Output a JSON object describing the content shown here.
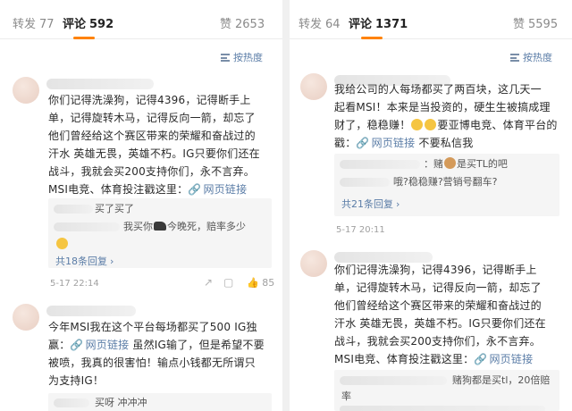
{
  "left": {
    "tabs": {
      "repost_label": "转发",
      "repost_count": "77",
      "comment_label": "评论",
      "comment_count": "592",
      "like_label": "赞",
      "like_count": "2653"
    },
    "sort_label": "按热度",
    "comment1": {
      "lines": [
        "你们记得洗澡狗，记得4396，记得断手上",
        "单，记得旋转木马，记得反向一箭，却忘了",
        "他们曾经给这个赛区带来的荣耀和奋战过的",
        "汗水 英雄无畏，英雄不朽。IG只要你们还在",
        "战斗，我就会买200支持你们，永不言弃。",
        "MSI电竞、体育投注戳这里："
      ],
      "link_text": "网页链接",
      "replies": [
        {
          "text": "买了买了"
        },
        {
          "text": "我买你",
          "text_after": "今晚死，赔率多少"
        }
      ],
      "more_replies": "共18条回复",
      "time": "5-17 22:14",
      "likes": "85"
    },
    "comment2": {
      "lines": [
        "今年MSI我在这个平台每场都买了500 IG独",
        "赢：",
        "被喷，我真的很害怕！输点小钱都无所谓只",
        "为支持IG！"
      ],
      "link_text": "网页链接",
      "line2_tail": "虽然IG输了，但是希望不要",
      "reply": "买呀  冲冲冲"
    }
  },
  "right": {
    "tabs": {
      "repost_label": "转发",
      "repost_count": "64",
      "comment_label": "评论",
      "comment_count": "1371",
      "like_label": "赞",
      "like_count": "5595"
    },
    "sort_label": "按热度",
    "comment1": {
      "lines": [
        "我给公司的人每场都买了两百块，这几天一",
        "起看MSI！本来是当投资的，硬生生被搞成理",
        "财了，稳稳赚！",
        "戳："
      ],
      "line3_tail": "要亚博电竞、体育平台的",
      "link_text": "网页链接",
      "line4_tail": "不要私信我",
      "replies": [
        {
          "text": "：赌",
          "text_after": "是买TL的吧"
        },
        {
          "text": "哦?稳稳赚?营销号翻车?"
        }
      ],
      "more_replies": "共21条回复",
      "time": "5-17 20:11"
    },
    "comment2": {
      "lines": [
        "你们记得洗澡狗，记得4396，记得断手上",
        "单，记得旋转木马，记得反向一箭，却忘了",
        "他们曾经给这个赛区带来的荣耀和奋战过的",
        "汗水 英雄无畏，英雄不朽。IG只要你们还在",
        "战斗，我就会买200支持你们，永不言弃。",
        "MSI电竞、体育投注戳这里："
      ],
      "link_text": "网页链接",
      "reply_line1": "赌狗都是买tl，20倍赔",
      "reply_line2": "率"
    }
  },
  "colors": {
    "accent": "#ff8200",
    "link": "#5b7da7"
  }
}
